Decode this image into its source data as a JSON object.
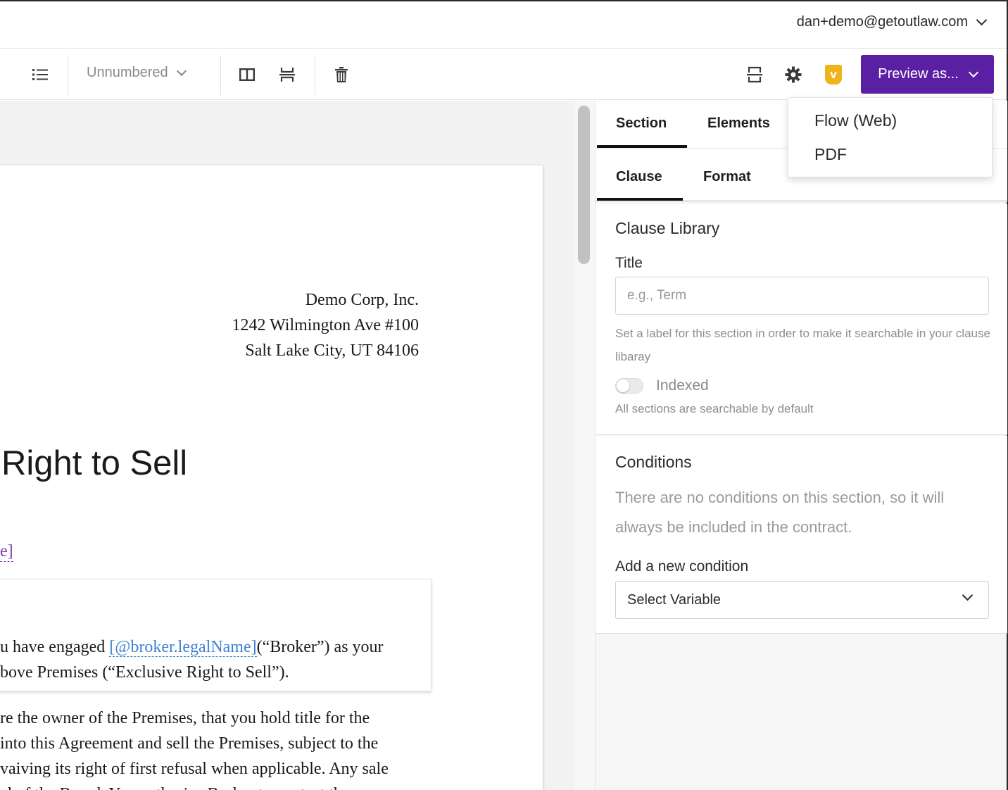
{
  "header": {
    "user_email": "dan+demo@getoutlaw.com"
  },
  "toolbar": {
    "numbering_label": "Unnumbered",
    "preview_label": "Preview as...",
    "v_badge": "v",
    "icons": [
      "list-icon",
      "columns-icon",
      "page-break-icon",
      "trash-icon",
      "split-section-icon",
      "gear-icon"
    ]
  },
  "preview_menu": {
    "items": [
      "Flow (Web)",
      "PDF"
    ]
  },
  "document": {
    "address_lines": [
      "Demo Corp, Inc.",
      "1242 Wilmington Ave #100",
      "Salt Lake City, UT 84106"
    ],
    "title": "Right to Sell",
    "variable_fragment": "e]",
    "clause_line1_pre": "u have engaged ",
    "clause_line1_var": "[@broker.legalName]",
    "clause_line1_post": "(“Broker”) as your",
    "clause_line2": "bove Premises (“Exclusive Right to Sell”).",
    "body_lines": [
      "re the owner of the Premises, that you hold title for the",
      "into this Agreement and sell the Premises, subject to the",
      "vaiving its right of first refusal when applicable. Any sale",
      "al of the Board. You authorize Broker to contact the"
    ]
  },
  "panel": {
    "tabs_top": [
      "Section",
      "Elements"
    ],
    "tabs_sub": [
      "Clause",
      "Format"
    ],
    "clause_library": {
      "heading": "Clause Library",
      "title_label": "Title",
      "title_placeholder": "e.g., Term",
      "title_value": "",
      "hint": "Set a label for this section in order to make it searchable in your clause libaray",
      "toggle_label": "Indexed",
      "toggle_on": false,
      "toggle_hint": "All sections are searchable by default"
    },
    "conditions": {
      "heading": "Conditions",
      "empty_text": "There are no conditions on this section, so it will always be included in the contract.",
      "add_label": "Add a new condition",
      "select_value": "Select Variable"
    }
  },
  "colors": {
    "accent_purple": "#5b1fa3",
    "variable_blue": "#3f7fd6",
    "variable_purple": "#7a3ab5",
    "badge_yellow": "#f0b41b"
  }
}
